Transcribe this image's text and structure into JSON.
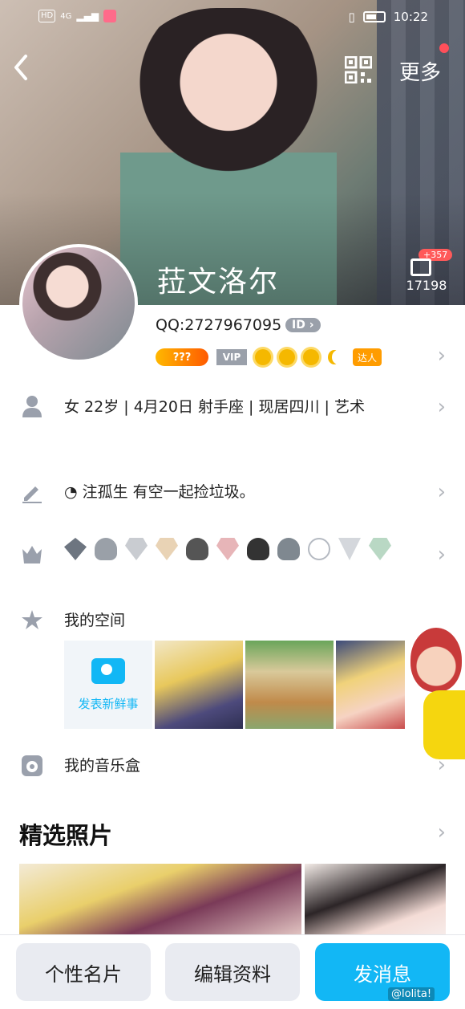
{
  "status_bar": {
    "network": "HD",
    "signal": "4G",
    "time": "10:22"
  },
  "nav": {
    "back_icon": "chevron-left-icon",
    "qr_icon": "qr-code-icon",
    "more_label": "更多"
  },
  "profile": {
    "nickname": "菈文洛尔",
    "qq_label": "QQ:2727967095",
    "id_badge": "ID",
    "likes_badge": "+357",
    "likes_count": "17198",
    "badges": {
      "coin_text": "???",
      "vip_text": "VIP",
      "daren_text": "达人"
    }
  },
  "info": {
    "basic": "女  22岁 | 4月20日  射手座 | 现居四川 | 艺术",
    "signature": "注孤生 有空一起捡垃圾。"
  },
  "space": {
    "title": "我的空间",
    "post_label": "发表新鲜事"
  },
  "music": {
    "title": "我的音乐盒"
  },
  "photos": {
    "title": "精选照片"
  },
  "bottom": {
    "card_label": "个性名片",
    "edit_label": "编辑资料",
    "message_label": "发消息"
  },
  "watermark": "@lolita!",
  "colors": {
    "accent": "#12b7f5",
    "alert": "#ff4f5a"
  }
}
